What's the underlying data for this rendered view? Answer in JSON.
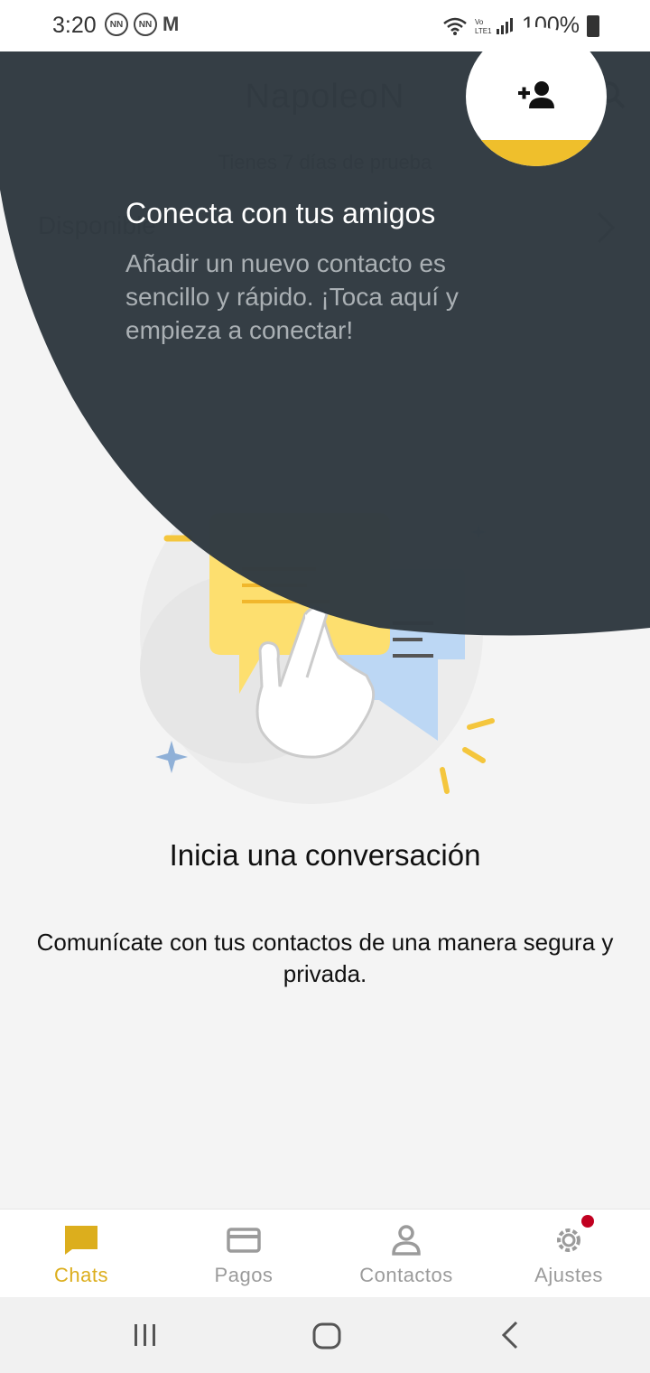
{
  "status_bar": {
    "time": "3:20",
    "notif_badge_1": "NN",
    "notif_badge_2": "NN",
    "gmail": "M",
    "battery": "100%"
  },
  "app": {
    "title": "NapoleoN",
    "trial_banner": "Tienes 7 días de prueba",
    "status_label": "Disponible"
  },
  "showcase": {
    "title": "Conecta con tus amigos",
    "description": "Añadir un nuevo contacto es sencillo y rápido. ¡Toca aquí y empieza a conectar!"
  },
  "empty_state": {
    "title": "Inicia una conversación",
    "description": "Comunícate con tus contactos de una manera segura y privada."
  },
  "bottom_nav": {
    "items": [
      {
        "label": "Chats",
        "icon": "chat-icon",
        "active": true
      },
      {
        "label": "Pagos",
        "icon": "card-icon",
        "active": false
      },
      {
        "label": "Contactos",
        "icon": "person-icon",
        "active": false
      },
      {
        "label": "Ajustes",
        "icon": "gear-icon",
        "active": false,
        "badge": true
      }
    ]
  },
  "colors": {
    "accent": "#dcae1d",
    "overlay": "#323b42",
    "badge": "#c10020",
    "spot_yellow": "#efbf2c"
  }
}
